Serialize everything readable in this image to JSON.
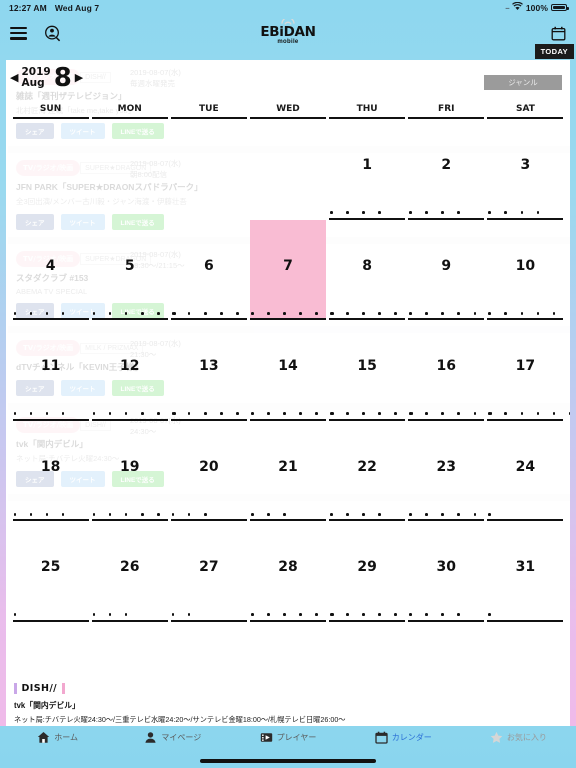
{
  "status_bar": {
    "time": "12:27 AM",
    "date": "Wed Aug 7",
    "signal_dots": "....",
    "wifi_icon": "wifi-icon",
    "battery_percent": "100%"
  },
  "navbar": {
    "menu_icon": "hamburger-menu-icon",
    "account_search_icon": "account-search-icon",
    "brand_title": "EBiDAN",
    "brand_subtitle": "mobile",
    "calendar_icon": "calendar-icon"
  },
  "today_button": {
    "label": "TODAY"
  },
  "month_selector": {
    "prev_icon": "prev-month-arrow-icon",
    "next_icon": "next-month-arrow-icon",
    "year": "2019",
    "month_abbr": "Aug",
    "month_number": "8"
  },
  "genre_button": {
    "label": "ジャンル"
  },
  "weekday_headers": [
    "SUN",
    "MON",
    "TUE",
    "WED",
    "THU",
    "FRI",
    "SAT"
  ],
  "calendar": {
    "today_date": 7,
    "weeks": [
      [
        {
          "day": "",
          "dots": 0
        },
        {
          "day": "",
          "dots": 0
        },
        {
          "day": "",
          "dots": 0
        },
        {
          "day": "",
          "dots": 0
        },
        {
          "day": "1",
          "dots": 4
        },
        {
          "day": "2",
          "dots": 4
        },
        {
          "day": "3",
          "dots": 4
        }
      ],
      [
        {
          "day": "4",
          "dots": 4
        },
        {
          "day": "5",
          "dots": 6
        },
        {
          "day": "6",
          "dots": 6
        },
        {
          "day": "7",
          "dots": 6
        },
        {
          "day": "8",
          "dots": 5
        },
        {
          "day": "9",
          "dots": 5
        },
        {
          "day": "10",
          "dots": 5
        }
      ],
      [
        {
          "day": "11",
          "dots": 4
        },
        {
          "day": "12",
          "dots": 6
        },
        {
          "day": "13",
          "dots": 5
        },
        {
          "day": "14",
          "dots": 6
        },
        {
          "day": "15",
          "dots": 6
        },
        {
          "day": "16",
          "dots": 6
        },
        {
          "day": "17",
          "dots": 6
        }
      ],
      [
        {
          "day": "18",
          "dots": 4
        },
        {
          "day": "19",
          "dots": 5
        },
        {
          "day": "20",
          "dots": 3
        },
        {
          "day": "21",
          "dots": 3
        },
        {
          "day": "22",
          "dots": 4
        },
        {
          "day": "23",
          "dots": 5
        },
        {
          "day": "24",
          "dots": 1
        }
      ],
      [
        {
          "day": "25",
          "dots": 1
        },
        {
          "day": "26",
          "dots": 3
        },
        {
          "day": "27",
          "dots": 2
        },
        {
          "day": "28",
          "dots": 6
        },
        {
          "day": "29",
          "dots": 5
        },
        {
          "day": "30",
          "dots": 4
        },
        {
          "day": "31",
          "dots": 1
        }
      ]
    ]
  },
  "ghost_events": [
    {
      "tag": "TV/ラジオ/映画",
      "date": "2019-08-07(水)",
      "time": "毎週水曜発売",
      "sub": "DISH//",
      "title": "雑誌「週刊ザテレビジョン」",
      "desc": "北村匠海 連載「take me,take you」"
    },
    {
      "tag": "TV/ラジオ/映画",
      "date": "2019-08-07(水)",
      "time": "朝8:00配信",
      "sub": "SUPER★DRAGON",
      "title": "JFN PARK「SUPER★DRAONスパドラパーク」",
      "desc": "全3回出演/メンバー古川毅・ジャン海渡・伊藤壮吾"
    },
    {
      "tag": "TV/ラジオ/映画",
      "date": "2019-08-07(水)",
      "time": "18:30〜/21:15〜",
      "sub": "SUPER★DRAGON",
      "title": "スタダクラブ #153",
      "desc": "ABEMA TV SPECIAL"
    },
    {
      "tag": "TV/ラジオ/映画",
      "date": "2019-08-07(水)",
      "time": "21:30〜",
      "sub": "M!LK / PRIZMAX",
      "title": "dTVチャンネル「KEVIN王子様」",
      "desc": ""
    },
    {
      "tag": "TV/ラジオ/映画",
      "date": "2019-08-07(水)",
      "time": "24:30〜",
      "sub": "DISH//",
      "title": "tvk「関内デビル」",
      "desc": "ネット局:チバテレ火曜24:30〜"
    }
  ],
  "ghost_share_buttons": {
    "facebook": "シェア",
    "twitter": "ツイート",
    "line": "LINEで送る"
  },
  "detail_panel": {
    "artist": "DISH//",
    "program": "tvk「関内デビル」",
    "networks": "ネット局:チバテレ火曜24:30〜/三重テレビ水曜24:20〜/サンテレビ金曜18:00〜/札幌テレビ日曜26:00〜"
  },
  "tabbar": [
    {
      "label": "ホーム",
      "icon": "home-icon",
      "state": "normal"
    },
    {
      "label": "マイページ",
      "icon": "person-icon",
      "state": "normal"
    },
    {
      "label": "プレイヤー",
      "icon": "player-icon",
      "state": "normal"
    },
    {
      "label": "カレンダー",
      "icon": "calendar-icon",
      "state": "active"
    },
    {
      "label": "お気に入り",
      "icon": "star-icon",
      "state": "dim"
    }
  ],
  "colors": {
    "today_highlight": "#f9bcd3",
    "accent_blue": "#2a6fd6",
    "header_gradient_start": "#8ed7ef",
    "header_gradient_end": "#f2b9e8",
    "tabbar": "#8cd6ee"
  }
}
